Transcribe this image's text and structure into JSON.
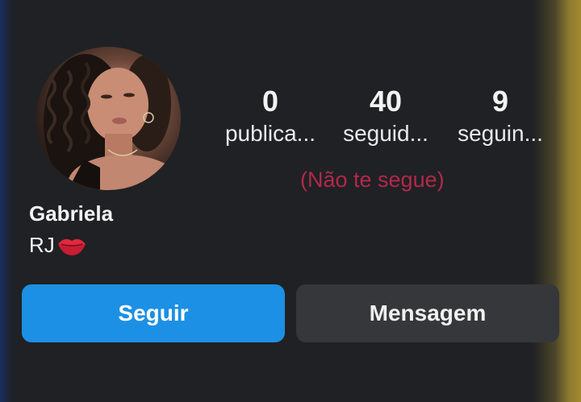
{
  "profile": {
    "name": "Gabriela",
    "bio_text": "RJ",
    "bio_emoji": "lips-kiss-icon",
    "avatar": "profile-photo"
  },
  "stats": {
    "posts": {
      "count": "0",
      "label": "publica..."
    },
    "followers": {
      "count": "40",
      "label": "seguid..."
    },
    "following": {
      "count": "9",
      "label": "seguin..."
    }
  },
  "relationship": {
    "status": "(Não te segue)"
  },
  "actions": {
    "follow_label": "Seguir",
    "message_label": "Mensagem"
  },
  "colors": {
    "background": "#1f2124",
    "follow_button": "#1c90e4",
    "message_button": "#36373a",
    "status_text": "#b3284b"
  }
}
